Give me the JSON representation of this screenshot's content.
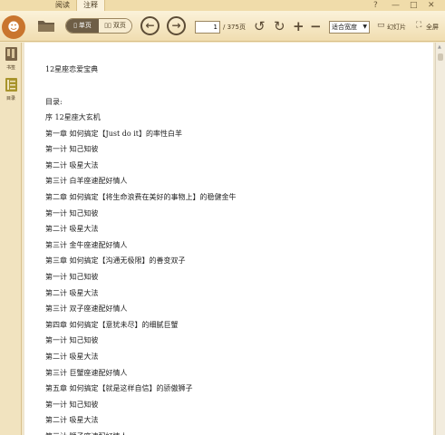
{
  "tabs": [
    "阅读",
    "注释"
  ],
  "window_controls": [
    "?",
    "—",
    "□",
    "✕"
  ],
  "toolbar": {
    "view_single": "单页",
    "view_double": "双页",
    "page_current": "1",
    "page_total": "/ 375页",
    "zoom_select": "适合宽度",
    "slideshow": "幻灯片",
    "fullscreen": "全屏"
  },
  "sidebar": {
    "items": [
      {
        "label": "书签",
        "icon": "bookmark-icon"
      },
      {
        "label": "目录",
        "icon": "contents-icon"
      }
    ]
  },
  "document": {
    "title": "12星座恋爱宝典",
    "toc_label": "目录:",
    "toc": [
      "序 12星座大玄机",
      "第一章 如何搞定【Just do it】的率性白羊",
      "第一计 知己知彼",
      "第二计 吸星大法",
      "第三计 白羊座速配好情人",
      "第二章 如何搞定【将生命浪费在美好的事物上】的稳健金牛",
      "第一计 知己知彼",
      "第二计 吸星大法",
      "第三计 金牛座速配好情人",
      "第三章 如何搞定【沟通无极限】的善变双子",
      "第一计 知己知彼",
      "第二计 吸星大法",
      "第三计 双子座速配好情人",
      "第四章 如何搞定【意犹未尽】的细腻巨蟹",
      "第一计 知己知彼",
      "第二计 吸星大法",
      "第三计 巨蟹座速配好情人",
      "第五章 如何搞定【就是这样自信】的骄傲狮子",
      "第一计 知己知彼",
      "第二计 吸星大法",
      "第三计 狮子座速配好情人"
    ]
  },
  "colors": {
    "toolbar_bg": "#f4e4bb",
    "accent_brown": "#6e5e46",
    "logo": "#c9752e"
  }
}
